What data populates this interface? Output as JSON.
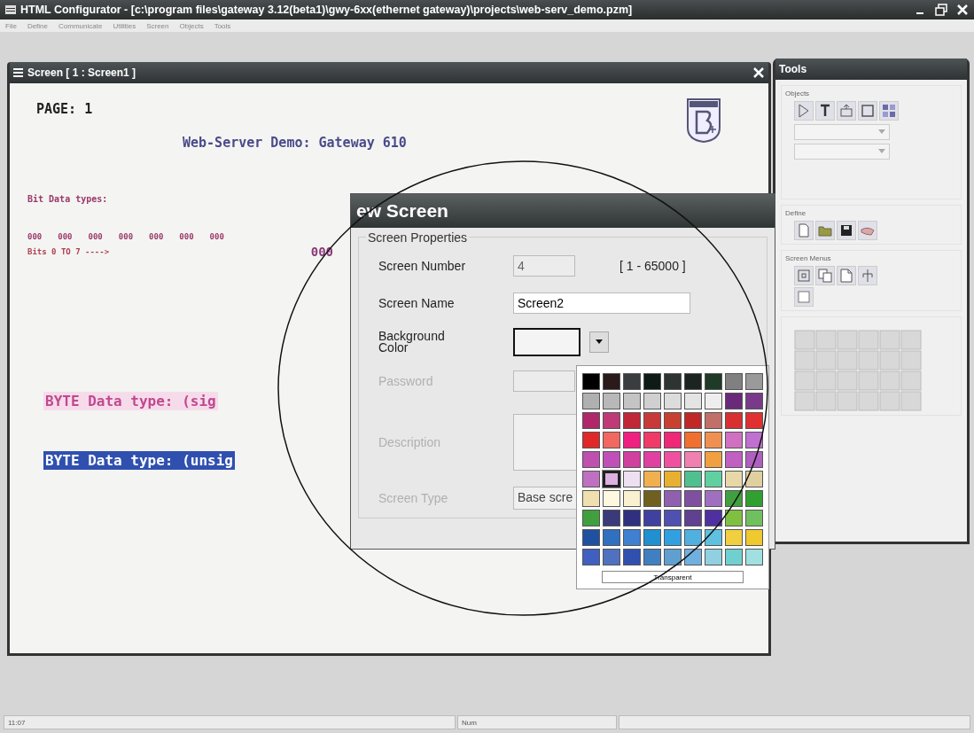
{
  "window": {
    "title": "HTML Configurator - [c:\\program files\\gateway 3.12(beta1)\\gwy-6xx(ethernet gateway)\\projects\\web-serv_demo.pzm]"
  },
  "menu": [
    "File",
    "Define",
    "Communicate",
    "Utilities",
    "Screen",
    "Objects",
    "Tools"
  ],
  "screen_window": {
    "title": "Screen [ 1 : Screen1 ]",
    "canvas": {
      "page_label": "PAGE: 1",
      "heading": "Web-Server Demo: Gateway 610",
      "bit_section_label": "Bit Data types:",
      "bit_lamps": [
        "000",
        "000",
        "000",
        "000",
        "000",
        "000",
        "000"
      ],
      "bits_caption": "Bits 0 TO 7 ---->",
      "bit_value": "000",
      "byte_fields": [
        {
          "text": "BYTE Data type: (sig",
          "selected": false
        },
        {
          "text": "BYTE Data type: (unsig",
          "selected": true
        }
      ]
    }
  },
  "dialog": {
    "title": "ew Screen",
    "group": "Screen Properties",
    "screen_number": {
      "label": "Screen Number",
      "value": "4",
      "range": "[ 1 - 65000 ]"
    },
    "screen_name": {
      "label": "Screen Name",
      "value": "Screen2"
    },
    "background_color": {
      "label": "Background Color"
    },
    "password": {
      "label": "Password"
    },
    "description": {
      "label": "Description"
    },
    "screen_type": {
      "label": "Screen Type",
      "value": "Base scre"
    }
  },
  "palette": {
    "rows": [
      [
        {
          "color": "#000000",
          "selected": false
        },
        {
          "color": "#2a1a1a",
          "selected": false
        },
        {
          "color": "#3a3d3f",
          "selected": false
        },
        {
          "color": "#0e1a16",
          "selected": false
        },
        {
          "color": "#2e3432",
          "selected": false
        },
        {
          "color": "#1c2422",
          "selected": false
        },
        {
          "color": "#1f3a26",
          "selected": false
        },
        {
          "color": "#808080",
          "selected": false
        },
        {
          "color": "#9a9a9a",
          "selected": false
        }
      ],
      [
        {
          "color": "#b0b0b0",
          "selected": false
        },
        {
          "color": "#b8b8b8",
          "selected": false
        },
        {
          "color": "#c4c4c4",
          "selected": false
        },
        {
          "color": "#d0d0d0",
          "selected": false
        },
        {
          "color": "#dcdcdc",
          "selected": false
        },
        {
          "color": "#e4e4e4",
          "selected": false
        },
        {
          "color": "#eeeeee",
          "selected": false
        },
        {
          "color": "#6a2a7a",
          "selected": false
        },
        {
          "color": "#7a3a8a",
          "selected": false
        }
      ],
      [
        {
          "color": "#b0286a",
          "selected": false
        },
        {
          "color": "#c03a78",
          "selected": false
        },
        {
          "color": "#c02838",
          "selected": false
        },
        {
          "color": "#c83a3a",
          "selected": false
        },
        {
          "color": "#c84030",
          "selected": false
        },
        {
          "color": "#c02828",
          "selected": false
        },
        {
          "color": "#c07068",
          "selected": false
        },
        {
          "color": "#d83030",
          "selected": false
        },
        {
          "color": "#e03030",
          "selected": false
        }
      ],
      [
        {
          "color": "#e02828",
          "selected": false
        },
        {
          "color": "#f06860",
          "selected": false
        },
        {
          "color": "#f02080",
          "selected": false
        },
        {
          "color": "#f03a68",
          "selected": false
        },
        {
          "color": "#f02878",
          "selected": false
        },
        {
          "color": "#f07030",
          "selected": false
        },
        {
          "color": "#f09050",
          "selected": false
        },
        {
          "color": "#d070c0",
          "selected": false
        },
        {
          "color": "#c070d0",
          "selected": false
        }
      ],
      [
        {
          "color": "#c050b0",
          "selected": false
        },
        {
          "color": "#c050b8",
          "selected": false
        },
        {
          "color": "#d040a0",
          "selected": false
        },
        {
          "color": "#e040a0",
          "selected": false
        },
        {
          "color": "#f050a0",
          "selected": false
        },
        {
          "color": "#f080b0",
          "selected": false
        },
        {
          "color": "#f0a040",
          "selected": false
        },
        {
          "color": "#c060c0",
          "selected": false
        },
        {
          "color": "#b060c0",
          "selected": false
        }
      ],
      [
        {
          "color": "#c070c0",
          "selected": false
        },
        {
          "color": "#dcb0e0",
          "selected": true
        },
        {
          "color": "#eee0f0",
          "selected": false
        },
        {
          "color": "#f0b050",
          "selected": false
        },
        {
          "color": "#e8b030",
          "selected": false
        },
        {
          "color": "#50c090",
          "selected": false
        },
        {
          "color": "#60d0a0",
          "selected": false
        },
        {
          "color": "#e8d8a8",
          "selected": false
        },
        {
          "color": "#e0d0a0",
          "selected": false
        }
      ],
      [
        {
          "color": "#f0e0b0",
          "selected": false
        },
        {
          "color": "#fff8e0",
          "selected": false
        },
        {
          "color": "#f8f0d0",
          "selected": false
        },
        {
          "color": "#706020",
          "selected": false
        },
        {
          "color": "#9060b0",
          "selected": false
        },
        {
          "color": "#8050a0",
          "selected": false
        },
        {
          "color": "#a070c0",
          "selected": false
        },
        {
          "color": "#40a040",
          "selected": false
        },
        {
          "color": "#30a030",
          "selected": false
        }
      ],
      [
        {
          "color": "#40a040",
          "selected": false
        },
        {
          "color": "#3a3a7a",
          "selected": false
        },
        {
          "color": "#303080",
          "selected": false
        },
        {
          "color": "#4040a0",
          "selected": false
        },
        {
          "color": "#5050b0",
          "selected": false
        },
        {
          "color": "#604090",
          "selected": false
        },
        {
          "color": "#5030a0",
          "selected": false
        },
        {
          "color": "#80c040",
          "selected": false
        },
        {
          "color": "#70c060",
          "selected": false
        }
      ],
      [
        {
          "color": "#2050a0",
          "selected": false
        },
        {
          "color": "#3070c0",
          "selected": false
        },
        {
          "color": "#4080d0",
          "selected": false
        },
        {
          "color": "#2090d0",
          "selected": false
        },
        {
          "color": "#30a0e0",
          "selected": false
        },
        {
          "color": "#50b0e0",
          "selected": false
        },
        {
          "color": "#60c0e0",
          "selected": false
        },
        {
          "color": "#f0d040",
          "selected": false
        },
        {
          "color": "#f0c830",
          "selected": false
        }
      ],
      [
        {
          "color": "#4060c0",
          "selected": false
        },
        {
          "color": "#5070c0",
          "selected": false
        },
        {
          "color": "#3050b0",
          "selected": false
        },
        {
          "color": "#4080c0",
          "selected": false
        },
        {
          "color": "#60a0d0",
          "selected": false
        },
        {
          "color": "#70b0e0",
          "selected": false
        },
        {
          "color": "#90d0e0",
          "selected": false
        },
        {
          "color": "#70d0d0",
          "selected": false
        },
        {
          "color": "#a0e0e0",
          "selected": false
        }
      ]
    ],
    "transparent_button": "Transparent"
  },
  "tools_window": {
    "title": "Tools",
    "sections": [
      {
        "label": "Objects"
      },
      {
        "label": "Define"
      },
      {
        "label": "Screen Menus"
      }
    ]
  },
  "status_bar": {
    "time": "11:07",
    "num": "Num"
  }
}
